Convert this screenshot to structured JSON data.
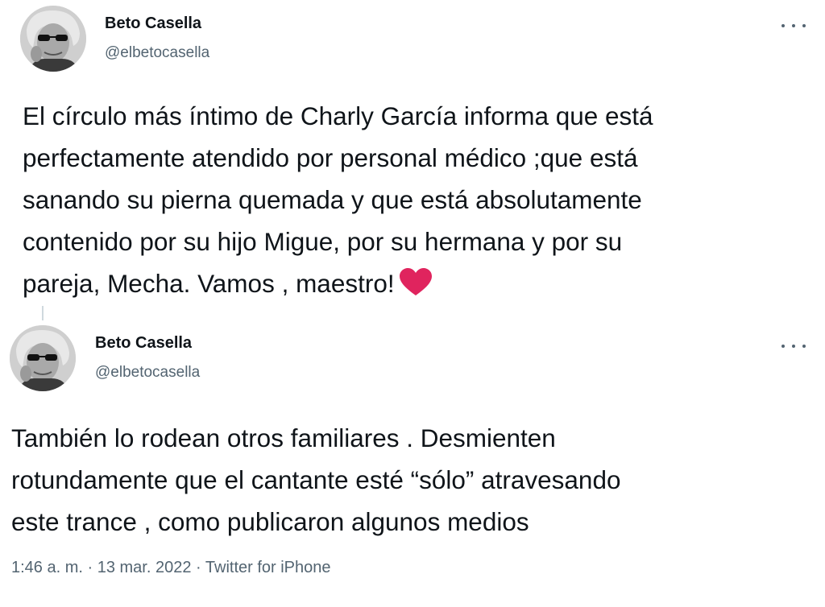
{
  "colors": {
    "text_primary": "#0f1419",
    "text_secondary": "#536471",
    "heart": "#e0245e",
    "thread_line": "#cfd9de"
  },
  "tweets": [
    {
      "author_name": "Beto Casella",
      "author_handle": "@elbetocasella",
      "text": "El círculo más íntimo de Charly García informa que está\nperfectamente atendido por personal médico ;que está\nsanando su pierna quemada y que está absolutamente\ncontenido por su hijo Migue, por su hermana y por su\npareja, Mecha. Vamos , maestro!",
      "emoji": "red-heart-icon"
    },
    {
      "author_name": "Beto Casella",
      "author_handle": "@elbetocasella",
      "text": "También lo rodean otros familiares . Desmienten\nrotundamente que el cantante esté “sólo” atravesando\neste trance , como publicaron algunos medios"
    }
  ],
  "meta": {
    "time": "1:46 a. m.",
    "separator": " · ",
    "date": "13 mar. 2022",
    "source": "Twitter for iPhone"
  },
  "icons": {
    "more": "more-options-icon",
    "avatar": "avatar"
  }
}
